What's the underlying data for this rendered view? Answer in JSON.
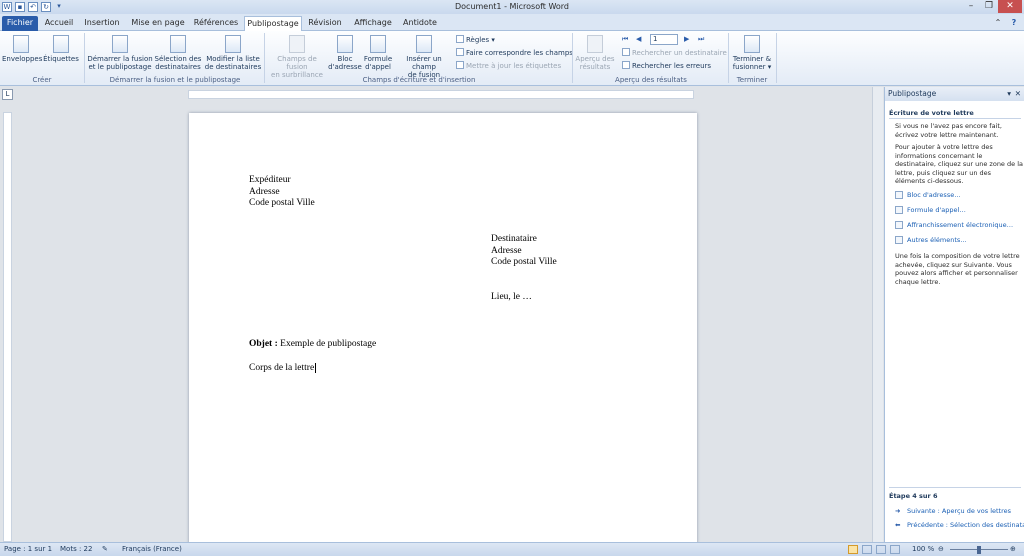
{
  "window": {
    "title": "Document1 - Microsoft Word"
  },
  "tabs": [
    "Fichier",
    "Accueil",
    "Insertion",
    "Mise en page",
    "Références",
    "Publipostage",
    "Révision",
    "Affichage",
    "Antidote"
  ],
  "ribbon": {
    "creer": {
      "enveloppes": "Enveloppes",
      "etiquettes": "Étiquettes",
      "group": "Créer"
    },
    "demarrer": {
      "demarrer_l1": "Démarrer la fusion",
      "demarrer_l2": "et le publipostage",
      "selection_l1": "Sélection des",
      "selection_l2": "destinataires",
      "modifier_l1": "Modifier la liste",
      "modifier_l2": "de destinataires",
      "group": "Démarrer la fusion et le publipostage"
    },
    "champs": {
      "surbrillance_l1": "Champs de fusion",
      "surbrillance_l2": "en surbrillance",
      "bloc_l1": "Bloc",
      "bloc_l2": "d'adresse",
      "formule_l1": "Formule",
      "formule_l2": "d'appel",
      "inserer_l1": "Insérer un champ",
      "inserer_l2": "de fusion",
      "regles": "Règles",
      "faire_correspondre": "Faire correspondre les champs",
      "mettre_a_jour": "Mettre à jour les étiquettes",
      "group": "Champs d'écriture et d'insertion"
    },
    "apercu": {
      "apercu_l1": "Aperçu des",
      "apercu_l2": "résultats",
      "record": "1",
      "rechercher_dest": "Rechercher un destinataire",
      "rechercher_err": "Rechercher les erreurs",
      "group": "Aperçu des résultats"
    },
    "terminer": {
      "l1": "Terminer &",
      "l2": "fusionner",
      "group": "Terminer"
    }
  },
  "document": {
    "sender": [
      "Expéditeur",
      "Adresse",
      "Code postal Ville"
    ],
    "recipient": [
      "Destinataire",
      "Adresse",
      "Code postal Ville"
    ],
    "place_date": "Lieu, le …",
    "subject_label": "Objet :",
    "subject_text": " Exemple de publipostage",
    "body": "Corps de la lettre"
  },
  "pane": {
    "title": "Publipostage",
    "heading": "Écriture de votre lettre",
    "p1": "Si vous ne l'avez pas encore fait, écrivez votre lettre maintenant.",
    "p2": "Pour ajouter à votre lettre des informations concernant le destinataire, cliquez sur une zone de la lettre, puis cliquez sur un des éléments ci-dessous.",
    "links": [
      "Bloc d'adresse…",
      "Formule d'appel…",
      "Affranchissement électronique…",
      "Autres éléments…"
    ],
    "p3": "Une fois la composition de votre lettre achevée, cliquez sur Suivante. Vous pouvez alors afficher et personnaliser chaque lettre.",
    "step": "Étape 4 sur 6",
    "next": "Suivante : Aperçu de vos lettres",
    "prev": "Précédente : Sélection des destinata"
  },
  "status": {
    "page": "Page : 1 sur 1",
    "words": "Mots : 22",
    "language": "Français (France)",
    "zoom": "100 %"
  }
}
